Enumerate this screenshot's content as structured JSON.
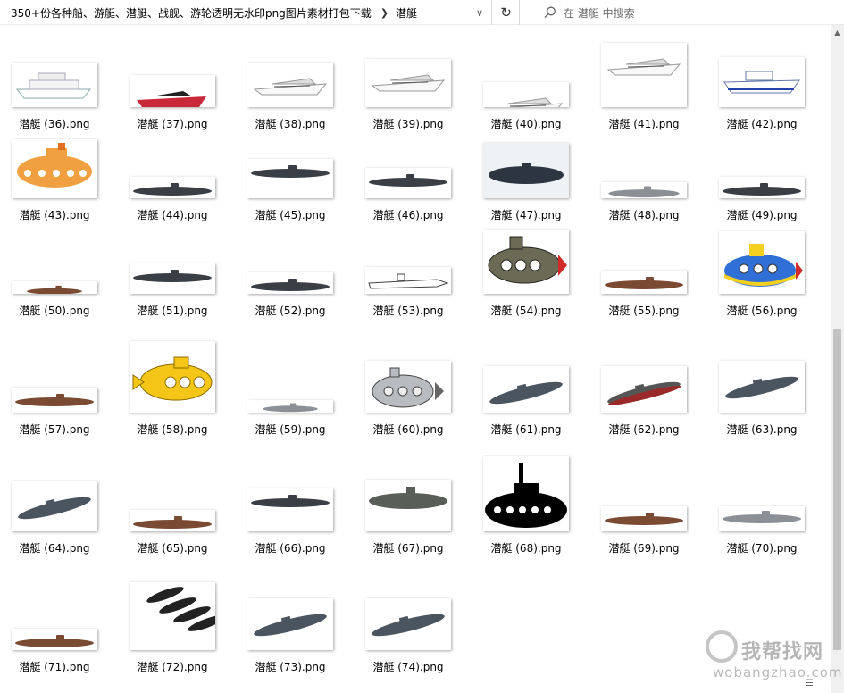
{
  "address_bar": {
    "path": [
      "350+份各种船、游艇、潜艇、战舰、游轮透明无水印png图片素材打包下载",
      "潜艇"
    ],
    "dropdown_icon": "chevron-down-icon",
    "refresh_icon": "refresh-icon"
  },
  "search": {
    "placeholder": "在 潜艇 中搜索",
    "icon": "search-icon"
  },
  "files": [
    {
      "name": "潜艇 (36).png",
      "kind": "cruise-ship"
    },
    {
      "name": "潜艇 (37).png",
      "kind": "speedboat-red"
    },
    {
      "name": "潜艇 (38).png",
      "kind": "yacht"
    },
    {
      "name": "潜艇 (39).png",
      "kind": "yacht"
    },
    {
      "name": "潜艇 (40).png",
      "kind": "yacht"
    },
    {
      "name": "潜艇 (41).png",
      "kind": "yacht"
    },
    {
      "name": "潜艇 (42).png",
      "kind": "patrol-boat"
    },
    {
      "name": "潜艇 (43).png",
      "kind": "cartoon-orange"
    },
    {
      "name": "潜艇 (44).png",
      "kind": "sub-dark"
    },
    {
      "name": "潜艇 (45).png",
      "kind": "sub-dark"
    },
    {
      "name": "潜艇 (46).png",
      "kind": "sub-dark"
    },
    {
      "name": "潜艇 (47).png",
      "kind": "sub-photo"
    },
    {
      "name": "潜艇 (48).png",
      "kind": "sub-grey"
    },
    {
      "name": "潜艇 (49).png",
      "kind": "sub-dark"
    },
    {
      "name": "潜艇 (50).png",
      "kind": "sub-brown"
    },
    {
      "name": "潜艇 (51).png",
      "kind": "sub-dark"
    },
    {
      "name": "潜艇 (52).png",
      "kind": "sub-dark"
    },
    {
      "name": "潜艇 (53).png",
      "kind": "sub-outline"
    },
    {
      "name": "潜艇 (54).png",
      "kind": "cartoon-olive"
    },
    {
      "name": "潜艇 (55).png",
      "kind": "sub-brown"
    },
    {
      "name": "潜艇 (56).png",
      "kind": "cartoon-blue"
    },
    {
      "name": "潜艇 (57).png",
      "kind": "sub-brown"
    },
    {
      "name": "潜艇 (58).png",
      "kind": "cartoon-yellow"
    },
    {
      "name": "潜艇 (59).png",
      "kind": "sub-grey"
    },
    {
      "name": "潜艇 (60).png",
      "kind": "cartoon-grey"
    },
    {
      "name": "潜艇 (61).png",
      "kind": "sub-diag"
    },
    {
      "name": "潜艇 (62).png",
      "kind": "sub-diag-red"
    },
    {
      "name": "潜艇 (63).png",
      "kind": "sub-diag"
    },
    {
      "name": "潜艇 (64).png",
      "kind": "sub-diag"
    },
    {
      "name": "潜艇 (65).png",
      "kind": "sub-brown"
    },
    {
      "name": "潜艇 (66).png",
      "kind": "sub-dark"
    },
    {
      "name": "潜艇 (67).png",
      "kind": "sub-olive"
    },
    {
      "name": "潜艇 (68).png",
      "kind": "silhouette"
    },
    {
      "name": "潜艇 (69).png",
      "kind": "sub-brown"
    },
    {
      "name": "潜艇 (70).png",
      "kind": "sub-grey"
    },
    {
      "name": "潜艇 (71).png",
      "kind": "sub-brown"
    },
    {
      "name": "潜艇 (72).png",
      "kind": "sub-group"
    },
    {
      "name": "潜艇 (73).png",
      "kind": "sub-diag"
    },
    {
      "name": "潜艇 (74).png",
      "kind": "sub-diag"
    }
  ],
  "watermark": {
    "cn": "我帮找网",
    "en": "wobangzhao.com"
  },
  "scroll_up_icon": "scroll-up-icon",
  "view_toggle_icon": "view-toggle-icon",
  "colors": {
    "hull_dark": "#3a3f45",
    "hull_brown": "#7a4a32",
    "hull_grey": "#8a9096",
    "cartoon_orange": "#f0a040",
    "cartoon_yellow": "#f5c518",
    "cartoon_blue": "#2f6fd6",
    "cartoon_olive": "#6b6a55",
    "hull_red": "#9a2a2a"
  }
}
